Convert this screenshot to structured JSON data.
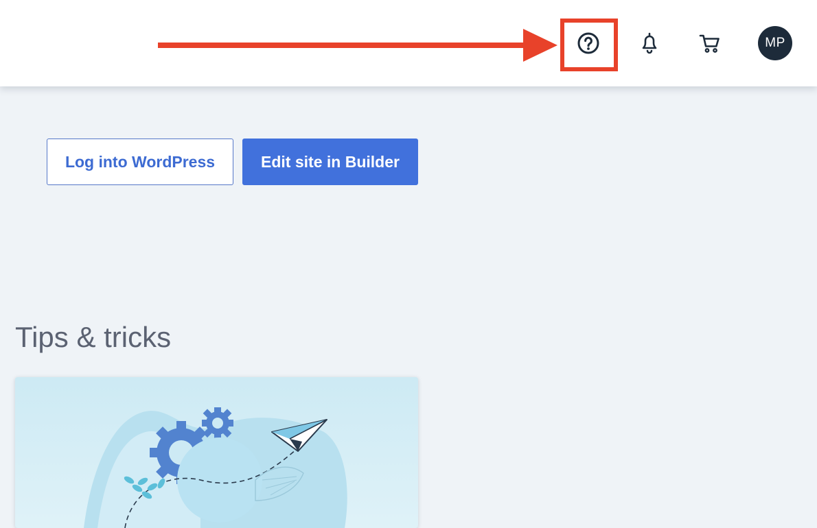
{
  "header": {
    "help_icon": "help-circle-icon",
    "notifications_icon": "bell-icon",
    "cart_icon": "cart-icon",
    "avatar_initials": "MP",
    "avatar_color": "#1d2b3a"
  },
  "annotation": {
    "color": "#e8422a",
    "target": "help-circle-icon"
  },
  "actions": {
    "login_label": "Log into WordPress",
    "builder_label": "Edit site in Builder",
    "accent_color": "#4171dc"
  },
  "tips": {
    "title": "Tips & tricks",
    "card_illustration": "gears-and-paper-plane-illustration"
  }
}
